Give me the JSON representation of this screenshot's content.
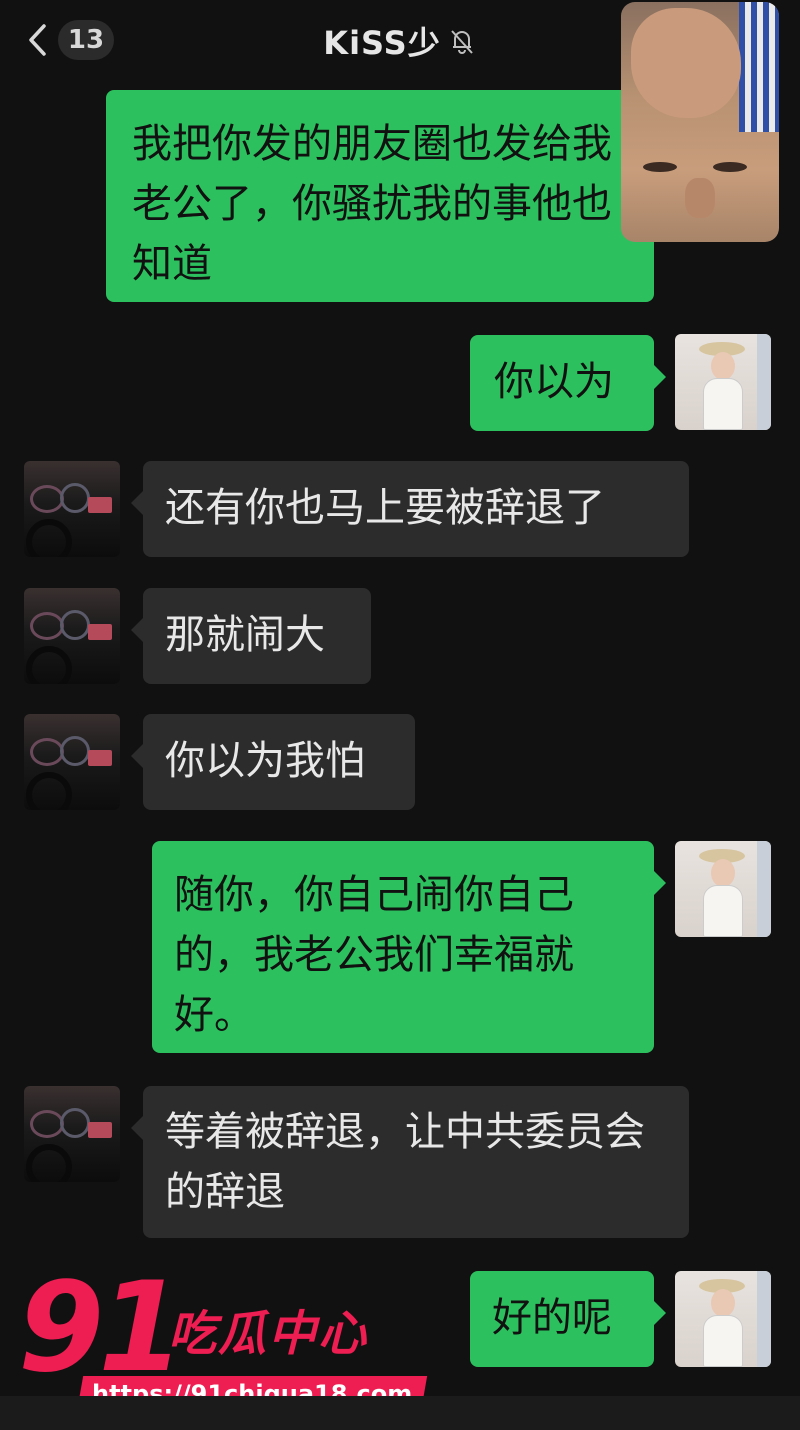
{
  "header": {
    "back_count": "13",
    "title": "KiSS少"
  },
  "messages": [
    {
      "side": "out",
      "text": "我把你发的朋友圈也发给我老公了，你骚扰我的事他也知道"
    },
    {
      "side": "out",
      "text": "你以为"
    },
    {
      "side": "in",
      "text": "还有你也马上要被辞退了"
    },
    {
      "side": "in",
      "text": "那就闹大"
    },
    {
      "side": "in",
      "text": "你以为我怕"
    },
    {
      "side": "out",
      "text": "随你，你自己闹你自己的，我老公我们幸福就好。"
    },
    {
      "side": "in",
      "text": "等着被辞退，让中共委员会的辞退"
    },
    {
      "side": "out",
      "text": "好的呢"
    }
  ],
  "watermark": {
    "number": "91",
    "name": "吃瓜中心",
    "url": "https://91chigua18.com"
  },
  "colors": {
    "background": "#111111",
    "outgoing_bubble": "#2dc05e",
    "incoming_bubble": "#2c2c2c",
    "watermark": "#ee1d52"
  },
  "icons": {
    "back": "chevron-left-icon",
    "mute": "bell-off-icon"
  }
}
